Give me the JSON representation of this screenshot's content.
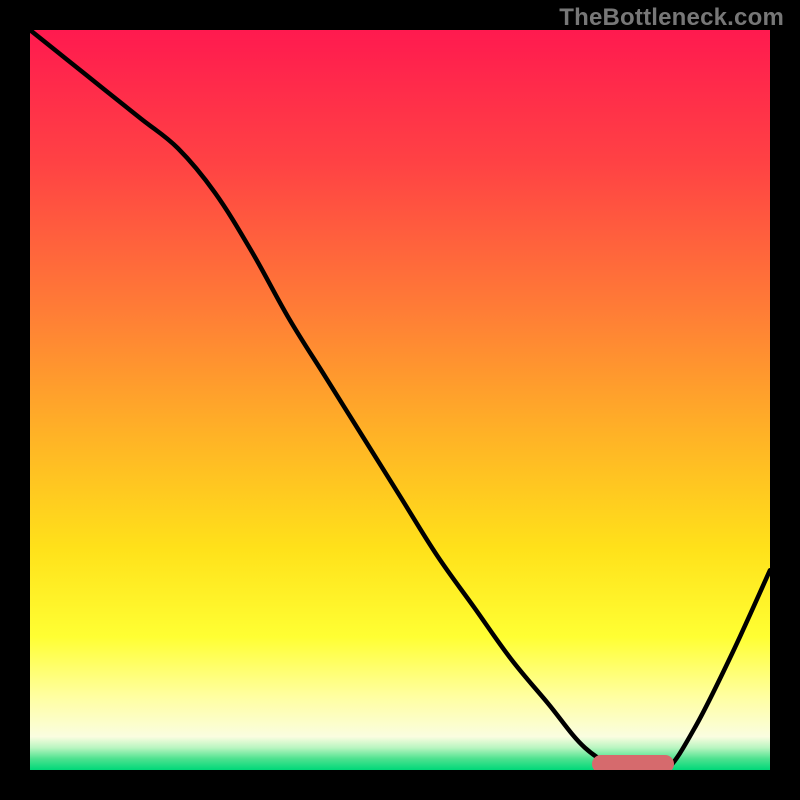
{
  "watermark": "TheBottleneck.com",
  "colors": {
    "frame": "#000000",
    "curve": "#000000",
    "marker": "#d66a6d",
    "gradient_stops": [
      {
        "offset": 0.0,
        "color": "#ff1a4f"
      },
      {
        "offset": 0.18,
        "color": "#ff4244"
      },
      {
        "offset": 0.38,
        "color": "#ff7d36"
      },
      {
        "offset": 0.55,
        "color": "#ffb326"
      },
      {
        "offset": 0.7,
        "color": "#ffe11a"
      },
      {
        "offset": 0.82,
        "color": "#ffff33"
      },
      {
        "offset": 0.9,
        "color": "#ffffa0"
      },
      {
        "offset": 0.955,
        "color": "#fafde0"
      },
      {
        "offset": 0.97,
        "color": "#b8f5c0"
      },
      {
        "offset": 0.985,
        "color": "#4de28f"
      },
      {
        "offset": 1.0,
        "color": "#00d879"
      }
    ]
  },
  "chart_data": {
    "type": "line",
    "title": "",
    "xlabel": "",
    "ylabel": "",
    "xlim": [
      0,
      100
    ],
    "ylim": [
      0,
      100
    ],
    "grid": false,
    "series": [
      {
        "name": "bottleneck-curve",
        "x": [
          0,
          5,
          10,
          15,
          20,
          25,
          30,
          35,
          40,
          45,
          50,
          55,
          60,
          65,
          70,
          75,
          80,
          83,
          86,
          90,
          95,
          100
        ],
        "values": [
          100,
          96,
          92,
          88,
          84,
          78,
          70,
          61,
          53,
          45,
          37,
          29,
          22,
          15,
          9,
          3,
          0,
          0,
          0,
          6,
          16,
          27
        ]
      }
    ],
    "annotations": [
      {
        "name": "optimal-range-marker",
        "x_start": 76,
        "x_end": 87,
        "y": 0
      }
    ]
  }
}
